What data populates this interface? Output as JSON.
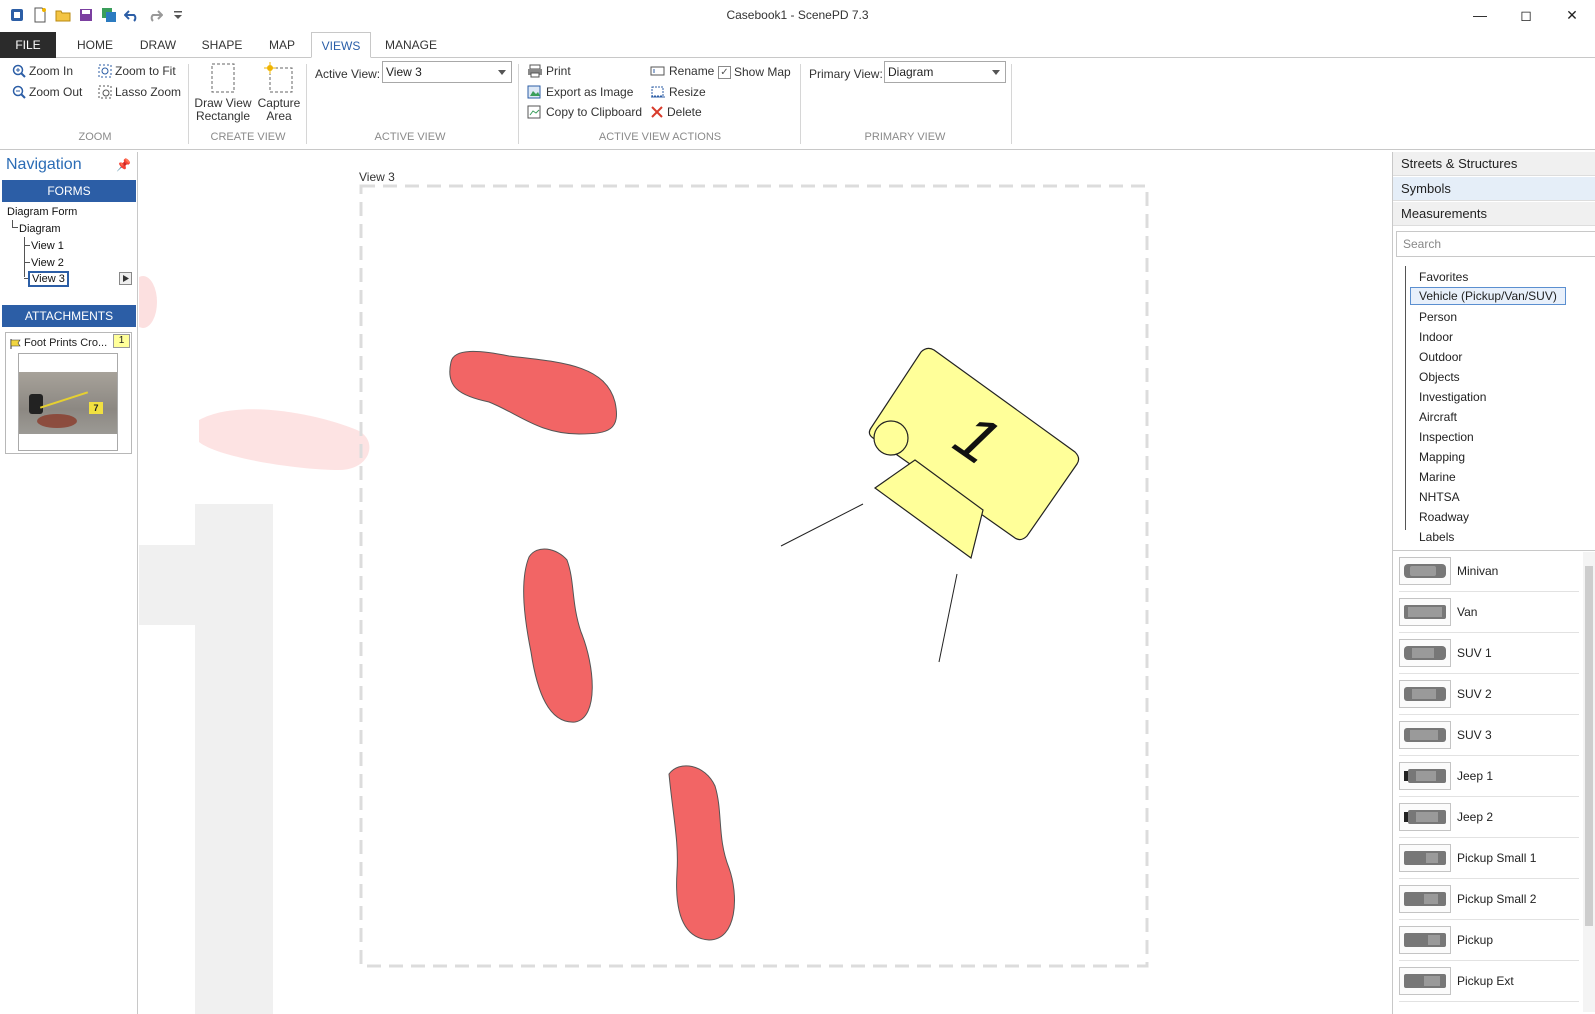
{
  "window": {
    "title": "Casebook1 - ScenePD 7.3"
  },
  "ribbon_tabs": [
    "FILE",
    "HOME",
    "DRAW",
    "SHAPE",
    "MAP",
    "VIEWS",
    "MANAGE"
  ],
  "ribbon": {
    "zoom": {
      "zoom_in": "Zoom In",
      "zoom_out": "Zoom Out",
      "zoom_to_fit": "Zoom to Fit",
      "lasso_zoom": "Lasso Zoom",
      "group": "ZOOM"
    },
    "create_view": {
      "draw_rect_1": "Draw View",
      "draw_rect_2": "Rectangle",
      "capture_1": "Capture",
      "capture_2": "Area",
      "group": "CREATE VIEW"
    },
    "active_view": {
      "label": "Active View:",
      "value": "View 3",
      "group": "ACTIVE VIEW"
    },
    "actions": {
      "print": "Print",
      "export": "Export as Image",
      "copy": "Copy to Clipboard",
      "rename": "Rename",
      "resize": "Resize",
      "delete": "Delete",
      "show_map": "Show Map",
      "show_map_checked": true,
      "group": "ACTIVE VIEW ACTIONS"
    },
    "primary_view": {
      "label": "Primary View:",
      "value": "Diagram",
      "group": "PRIMARY VIEW"
    }
  },
  "navigation": {
    "title": "Navigation",
    "forms_label": "FORMS",
    "tree": {
      "root": "Diagram Form",
      "child": "Diagram",
      "views": [
        "View 1",
        "View 2",
        "View 3"
      ],
      "selected": "View 3"
    },
    "attachments_label": "ATTACHMENTS",
    "attachment": {
      "name": "Foot Prints Cro...",
      "count": "1",
      "marker": "7"
    }
  },
  "canvas": {
    "view_label": "View 3",
    "marker_number": "1"
  },
  "right_panel": {
    "sections": [
      "Streets & Structures",
      "Symbols",
      "Measurements"
    ],
    "selected_section": "Symbols",
    "search_placeholder": "Search",
    "categories": [
      "Favorites",
      "Vehicle (Pickup/Van/SUV)",
      "Person",
      "Indoor",
      "Outdoor",
      "Objects",
      "Investigation",
      "Aircraft",
      "Inspection",
      "Mapping",
      "Marine",
      "NHTSA",
      "Roadway",
      "Labels"
    ],
    "selected_category": "Vehicle (Pickup/Van/SUV)",
    "symbols": [
      "Minivan",
      "Van",
      "SUV 1",
      "SUV 2",
      "SUV 3",
      "Jeep 1",
      "Jeep 2",
      "Pickup Small 1",
      "Pickup Small 2",
      "Pickup",
      "Pickup Ext"
    ]
  },
  "colors": {
    "accent": "#2c5ea6",
    "footprint": "#f26565",
    "marker": "#ffff99"
  }
}
